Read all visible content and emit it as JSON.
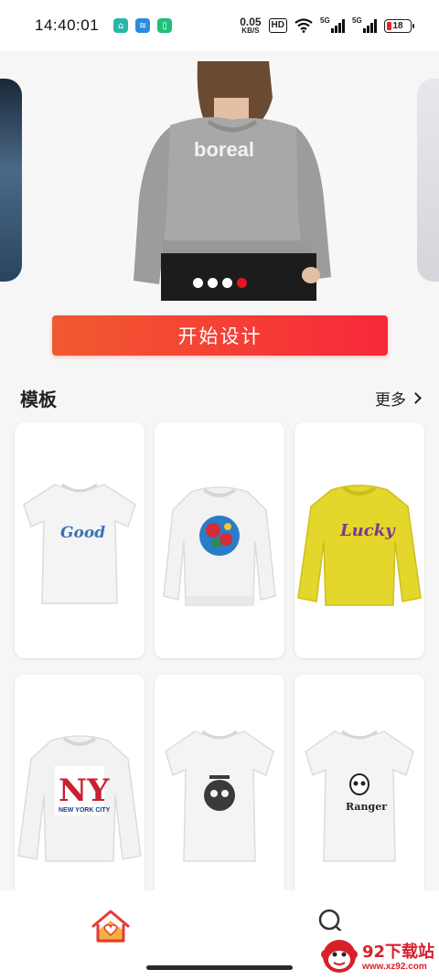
{
  "status_bar": {
    "time": "14:40:01",
    "net_speed": "0.05",
    "net_unit": "KB/S",
    "hd_label": "HD",
    "signal_1": "5G",
    "signal_2": "5G",
    "battery": "18"
  },
  "banner": {
    "shirt_text": "boreal",
    "dots": 4,
    "active_dot": 4
  },
  "cta": {
    "label": "开始设计"
  },
  "templates_section": {
    "title": "模板",
    "more_label": "更多"
  },
  "templates": [
    {
      "print": "Good",
      "shirt_color": "#f4f4f4",
      "style": "tee"
    },
    {
      "print": "",
      "shirt_color": "#f2f2f2",
      "style": "sweatshirt"
    },
    {
      "print": "Lucky",
      "shirt_color": "#e4d62a",
      "style": "sweatshirt"
    },
    {
      "print": "NY",
      "print_sub": "NEW YORK CITY",
      "shirt_color": "#f2f2f2",
      "style": "sweatshirt"
    },
    {
      "print": "",
      "shirt_color": "#f4f4f4",
      "style": "tee"
    },
    {
      "print": "Ranger",
      "shirt_color": "#f4f4f4",
      "style": "tee"
    }
  ],
  "bottom_nav": {
    "home_icon": "home-heart-icon",
    "search_icon": "search-icon"
  },
  "watermark": {
    "title": "92下载站",
    "url": "www.xz92.com"
  },
  "colors": {
    "accent": "#e3161e",
    "cta_start": "#f05a30",
    "cta_end": "#f8283a",
    "nav_home_accent": "#f5b13d"
  }
}
